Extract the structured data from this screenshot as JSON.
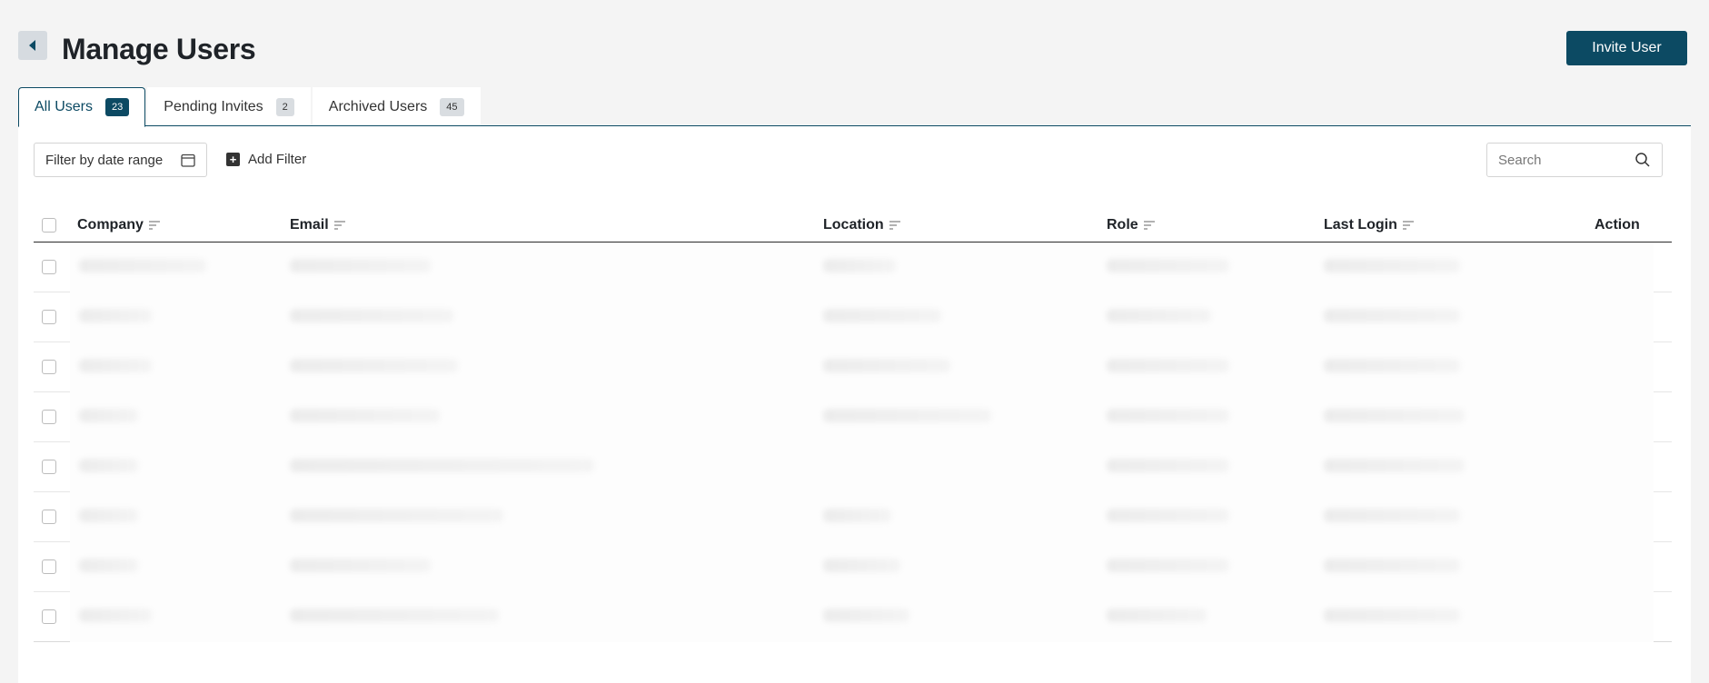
{
  "header": {
    "title": "Manage Users",
    "invite_label": "Invite User"
  },
  "tabs": [
    {
      "label": "All Users",
      "count": "23"
    },
    {
      "label": "Pending Invites",
      "count": "2"
    },
    {
      "label": "Archived Users",
      "count": "45"
    }
  ],
  "toolbar": {
    "date_filter_label": "Filter by date range",
    "add_filter_label": "Add Filter",
    "search_placeholder": "Search"
  },
  "table": {
    "columns": [
      "Company",
      "Email",
      "Location",
      "Role",
      "Last Login",
      "Action"
    ],
    "row_count": 8
  },
  "colors": {
    "accent": "#0c4a63",
    "background": "#f4f4f4"
  }
}
